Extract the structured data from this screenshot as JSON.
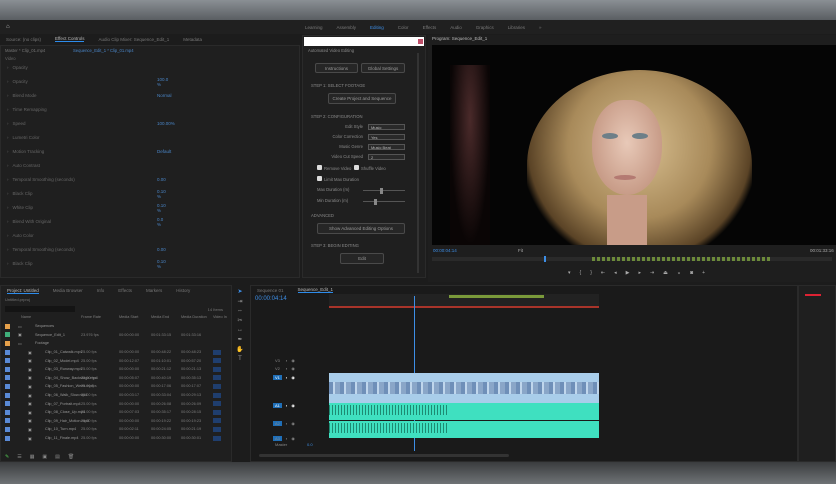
{
  "workspaces": {
    "items": [
      "Learning",
      "Assembly",
      "Editing",
      "Color",
      "Effects",
      "Audio",
      "Graphics",
      "Libraries"
    ],
    "active": 2
  },
  "left_tabs": [
    "Source: (no clips)",
    "Effect Controls",
    "Audio Clip Mixer: Sequence_Edit_1",
    "Metadata"
  ],
  "effect_controls": {
    "header_master": "Master * Clip_01.mp4",
    "header_clip": "Sequence_Edit_1 * Clip_01.mp4",
    "section": "Video",
    "rows": [
      {
        "label": "Opacity",
        "value": ""
      },
      {
        "label": "Opacity",
        "value": "100.0 %"
      },
      {
        "label": "Blend Mode",
        "value": "Normal"
      },
      {
        "label": "Time Remapping",
        "value": ""
      },
      {
        "label": "Speed",
        "value": "100.00%"
      },
      {
        "label": "Lumetri Color",
        "value": ""
      },
      {
        "label": "Motion Tracking",
        "value": "Default"
      },
      {
        "label": "Auto Contrast",
        "value": ""
      },
      {
        "label": "Temporal Smoothing (seconds)",
        "value": "0.00"
      },
      {
        "label": "Black Clip",
        "value": "0.10 %"
      },
      {
        "label": "White Clip",
        "value": "0.10 %"
      },
      {
        "label": "Blend With Original",
        "value": "0.0 %"
      },
      {
        "label": "Auto Color",
        "value": ""
      },
      {
        "label": "Temporal Smoothing (seconds)",
        "value": "0.00"
      },
      {
        "label": "Black Clip",
        "value": "0.10 %"
      }
    ],
    "timecode": "00:00:04:14"
  },
  "auto_edit": {
    "title": "Automated Video Editing",
    "btn_instructions": "Instructions",
    "btn_settings": "Global Settings",
    "step1": "STEP 1: SELECT FOOTAGE",
    "btn_create": "Create Project and Sequence",
    "step2": "STEP 2: CONFIGURATION",
    "fields": [
      {
        "label": "Edit Style",
        "value": "Music"
      },
      {
        "label": "Color Correction",
        "value": "Yes"
      },
      {
        "label": "Music Genre",
        "value": "Music Beat"
      },
      {
        "label": "Video Cut Speed",
        "value": "2"
      }
    ],
    "chk_remove": "Remove Video",
    "chk_shuffle": "Shuffle Video",
    "chk_limit": "Limit Max Duration",
    "slider1": "Max Duration (m)",
    "slider1_value": 0.4,
    "slider2": "Min Duration (m)",
    "slider2_value": 0.25,
    "advanced": "ADVANCED",
    "btn_advanced": "Show Advanced Editing Options",
    "step3": "STEP 3: BEGIN EDITING",
    "btn_edit": "Edit"
  },
  "program": {
    "title": "Program: Sequence_Edit_1",
    "timecode_left": "00:00:04:14",
    "timecode_right": "00:01:33:16",
    "fit": "Fit",
    "progress": 0.28
  },
  "project": {
    "tabs": [
      "Project: Untitled",
      "Media Browser",
      "Info",
      "Effects",
      "Markers",
      "History"
    ],
    "subtitle": "Untitled.prproj",
    "items_count": "14 Items",
    "columns": [
      "Name",
      "Frame Rate",
      "Media Start",
      "Media End",
      "Media Duration",
      "Video In"
    ],
    "rows": [
      {
        "name": "Sequences",
        "type": "folder",
        "rate": "",
        "start": "",
        "end": "",
        "dur": "",
        "color": "#e5a04a"
      },
      {
        "name": "Sequence_Edit_1",
        "type": "seq",
        "rate": "23.976 fps",
        "start": "00:00:00:00",
        "end": "00:01:33:15",
        "dur": "00:01:33:16",
        "color": "#3fae7a"
      },
      {
        "name": "Footage",
        "type": "folder",
        "rate": "",
        "start": "",
        "end": "",
        "dur": "",
        "color": "#e5a04a"
      },
      {
        "name": "Clip_01_Catwalk.mp4",
        "rate": "25.00 fps",
        "start": "00:00:00:00",
        "end": "00:00:48:22",
        "dur": "00:00:48:23",
        "color": "#5a8ad6"
      },
      {
        "name": "Clip_02_Model.mp4",
        "rate": "25.00 fps",
        "start": "00:00:12:07",
        "end": "00:01:10:01",
        "dur": "00:00:57:20",
        "color": "#5a8ad6"
      },
      {
        "name": "Clip_03_Runway.mp4",
        "rate": "25.00 fps",
        "start": "00:00:00:00",
        "end": "00:00:21:12",
        "dur": "00:00:21:13",
        "color": "#5a8ad6"
      },
      {
        "name": "Clip_04_Show_Backstage.mp4",
        "rate": "25.00 fps",
        "start": "00:00:05:07",
        "end": "00:00:40:19",
        "dur": "00:00:35:13",
        "color": "#5a8ad6"
      },
      {
        "name": "Clip_05_Fashion_Week.mp4",
        "rate": "25.00 fps",
        "start": "00:00:00:00",
        "end": "00:00:17:06",
        "dur": "00:00:17:07",
        "color": "#5a8ad6"
      },
      {
        "name": "Clip_06_Walk_Slow.mp4",
        "rate": "25.00 fps",
        "start": "00:00:03:17",
        "end": "00:00:33:04",
        "dur": "00:00:29:13",
        "color": "#5a8ad6"
      },
      {
        "name": "Clip_07_Portrait.mp4",
        "rate": "25.00 fps",
        "start": "00:00:00:00",
        "end": "00:00:26:08",
        "dur": "00:00:26:09",
        "color": "#5a8ad6"
      },
      {
        "name": "Clip_08_Close_Up.mp4",
        "rate": "25.00 fps",
        "start": "00:00:07:03",
        "end": "00:00:35:17",
        "dur": "00:00:28:15",
        "color": "#5a8ad6"
      },
      {
        "name": "Clip_09_Hair_Motion.mp4",
        "rate": "25.00 fps",
        "start": "00:00:00:00",
        "end": "00:00:19:22",
        "dur": "00:00:19:23",
        "color": "#5a8ad6"
      },
      {
        "name": "Clip_10_Turn.mp4",
        "rate": "25.00 fps",
        "start": "00:00:02:11",
        "end": "00:00:24:05",
        "dur": "00:00:21:19",
        "color": "#5a8ad6"
      },
      {
        "name": "Clip_11_Finale.mp4",
        "rate": "25.00 fps",
        "start": "00:00:00:00",
        "end": "00:00:30:00",
        "dur": "00:00:30:01",
        "color": "#5a8ad6"
      }
    ]
  },
  "timeline": {
    "tabs": [
      "Sequence 01",
      "Sequence_Edit_1"
    ],
    "timecode": "00:00:04:14",
    "tracks": [
      "V3",
      "V2",
      "V1",
      "A1",
      "A2",
      "A3"
    ],
    "master": "Master",
    "master_value": "0.0"
  },
  "colors": {
    "accent": "#2d8ceb",
    "video_clip": "#a9cdea",
    "audio_clip": "#3fe0c0"
  }
}
